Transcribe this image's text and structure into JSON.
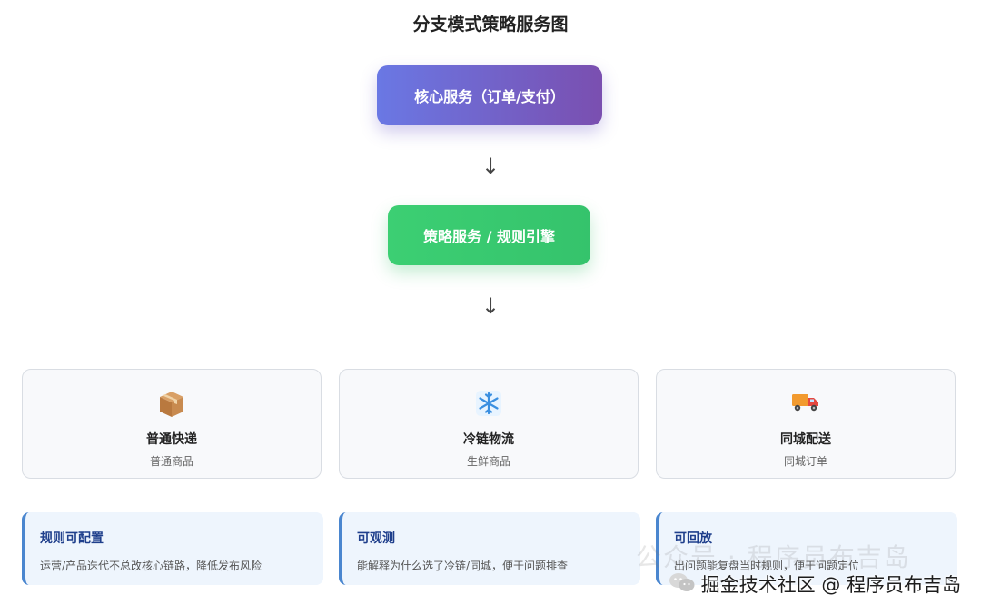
{
  "title": "分支模式策略服务图",
  "nodes": {
    "core": "核心服务（订单/支付）",
    "strategy": "策略服务 / 规则引擎"
  },
  "arrow_glyph": "↓",
  "branches": [
    {
      "icon": "package-box-icon",
      "name": "普通快递",
      "desc": "普通商品"
    },
    {
      "icon": "snowflake-icon",
      "name": "冷链物流",
      "desc": "生鲜商品"
    },
    {
      "icon": "delivery-truck-icon",
      "name": "同城配送",
      "desc": "同城订单"
    }
  ],
  "features": [
    {
      "title": "规则可配置",
      "desc": "运营/产品迭代不总改核心链路，降低发布风险"
    },
    {
      "title": "可观测",
      "desc": "能解释为什么选了冷链/同城，便于问题排查"
    },
    {
      "title": "可回放",
      "desc": "出问题能复盘当时规则，便于问题定位"
    }
  ],
  "watermark": {
    "text": "掘金技术社区 @ 程序员布吉岛",
    "faint_text": "公众号 · 程序员布吉岛"
  },
  "colors": {
    "core_gradient": [
      "#6a78e4",
      "#7a4fb0"
    ],
    "strategy_gradient": [
      "#3ccf73",
      "#35c36c"
    ],
    "feature_accent": "#4a86cf",
    "feature_title": "#1f3f8c"
  }
}
